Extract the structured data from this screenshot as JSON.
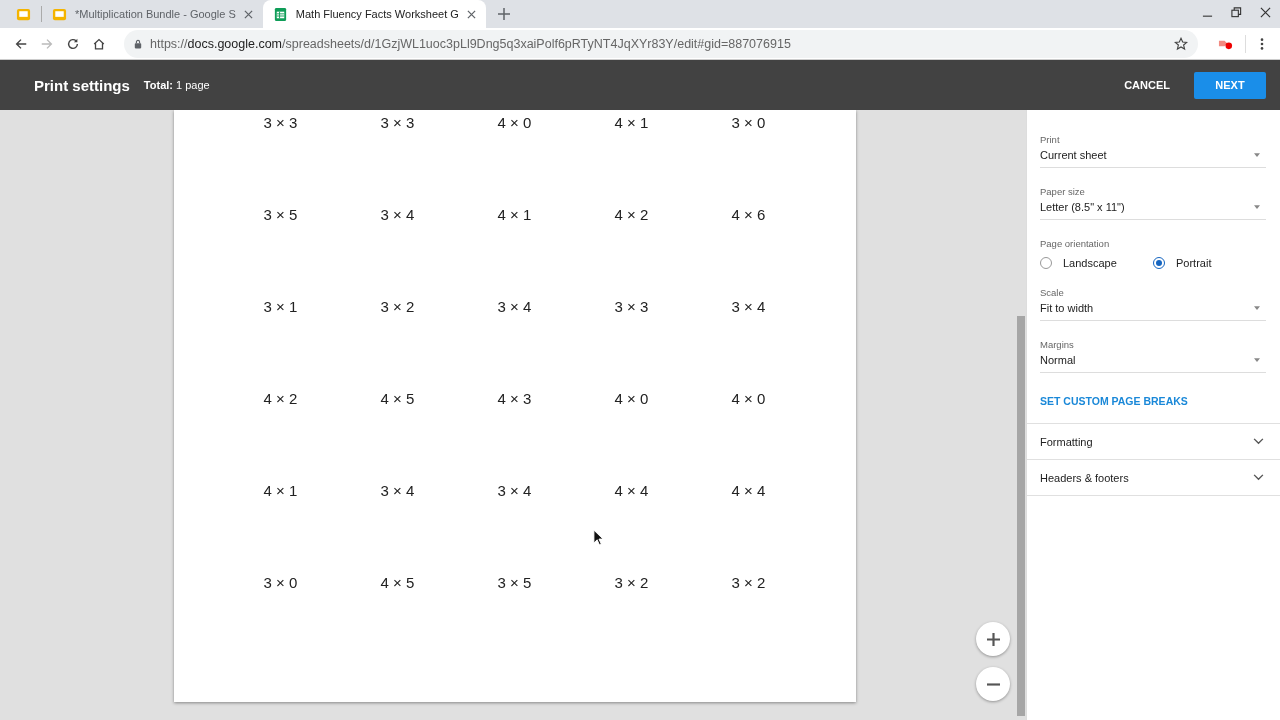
{
  "browser": {
    "tabs": [
      {
        "kind": "slides",
        "selected": false
      },
      {
        "kind": "slides",
        "title": "*Multiplication Bundle - Google S",
        "selected": false
      },
      {
        "kind": "sheets",
        "title": "Math Fluency Facts Worksheet G",
        "selected": true
      }
    ],
    "url": {
      "prefix": "https://",
      "host": "docs.google.com",
      "path": "/spreadsheets/d/1GzjWL1uoc3pLl9Dng5q3xaiPolf6pRTyNT4JqXYr83Y/edit#gid=887076915"
    }
  },
  "header": {
    "title": "Print settings",
    "total_label": "Total:",
    "total_value": "1 page",
    "cancel": "CANCEL",
    "next": "NEXT"
  },
  "preview": {
    "rows": [
      [
        "3 × 3",
        "3 × 3",
        "4 × 0",
        "4 × 1",
        "3 × 0"
      ],
      [
        "3 × 5",
        "3 × 4",
        "4 × 1",
        "4 × 2",
        "4 × 6"
      ],
      [
        "3 × 1",
        "3 × 2",
        "3 × 4",
        "3 × 3",
        "3 × 4"
      ],
      [
        "4 × 2",
        "4 × 5",
        "4 × 3",
        "4 × 0",
        "4 × 0"
      ],
      [
        "4 × 1",
        "3 × 4",
        "3 × 4",
        "4 × 4",
        "4 × 4"
      ],
      [
        "3 × 0",
        "4 × 5",
        "3 × 5",
        "3 × 2",
        "3 × 2"
      ]
    ]
  },
  "settings": [
    {
      "kind": "select",
      "label": "Print",
      "value": "Current sheet"
    },
    {
      "kind": "select",
      "label": "Paper size",
      "value": "Letter (8.5\" x 11\")"
    },
    {
      "kind": "radio",
      "label": "Page orientation",
      "options": [
        {
          "label": "Landscape",
          "selected": false
        },
        {
          "label": "Portrait",
          "selected": true
        }
      ]
    },
    {
      "kind": "select",
      "label": "Scale",
      "value": "Fit to width"
    },
    {
      "kind": "select",
      "label": "Margins",
      "value": "Normal"
    },
    {
      "kind": "link",
      "label": "SET CUSTOM PAGE BREAKS"
    },
    {
      "kind": "section",
      "label": "Formatting",
      "expanded": false
    },
    {
      "kind": "section",
      "label": "Headers & footers",
      "expanded": false
    }
  ]
}
